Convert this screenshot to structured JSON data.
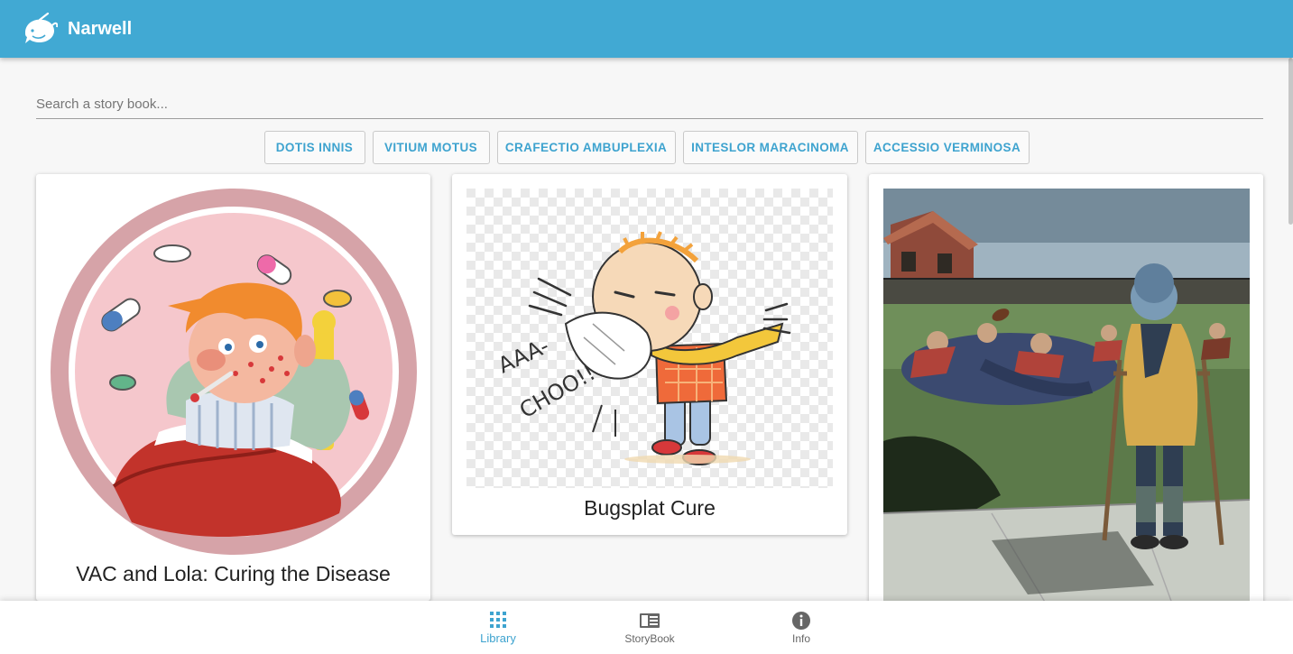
{
  "app": {
    "title": "Narwell",
    "brand_color": "#41a9d3",
    "logo_icon": "narwhal-icon"
  },
  "search": {
    "placeholder": "Search a story book...",
    "value": ""
  },
  "categories": [
    "DOTIS INNIS",
    "VITIUM MOTUS",
    "CRAFECTIO AMBUPLEXIA",
    "INTESLOR MARACINOMA",
    "ACCESSIO VERMINOSA"
  ],
  "books": [
    {
      "title": "VAC and Lola: Curing the Disease",
      "image": "sick-boy-in-bed-illustration"
    },
    {
      "title": "Bugsplat Cure",
      "image": "sneezing-child-illustration"
    },
    {
      "title": "",
      "image": "boy-on-crutches-watching-football-illustration"
    }
  ],
  "bottom_nav": [
    {
      "label": "Library",
      "icon": "grid-icon",
      "active": true
    },
    {
      "label": "StoryBook",
      "icon": "book-icon",
      "active": false
    },
    {
      "label": "Info",
      "icon": "info-icon",
      "active": false
    }
  ],
  "colors": {
    "accent": "#3ea3cf",
    "background": "#f7f7f7"
  }
}
